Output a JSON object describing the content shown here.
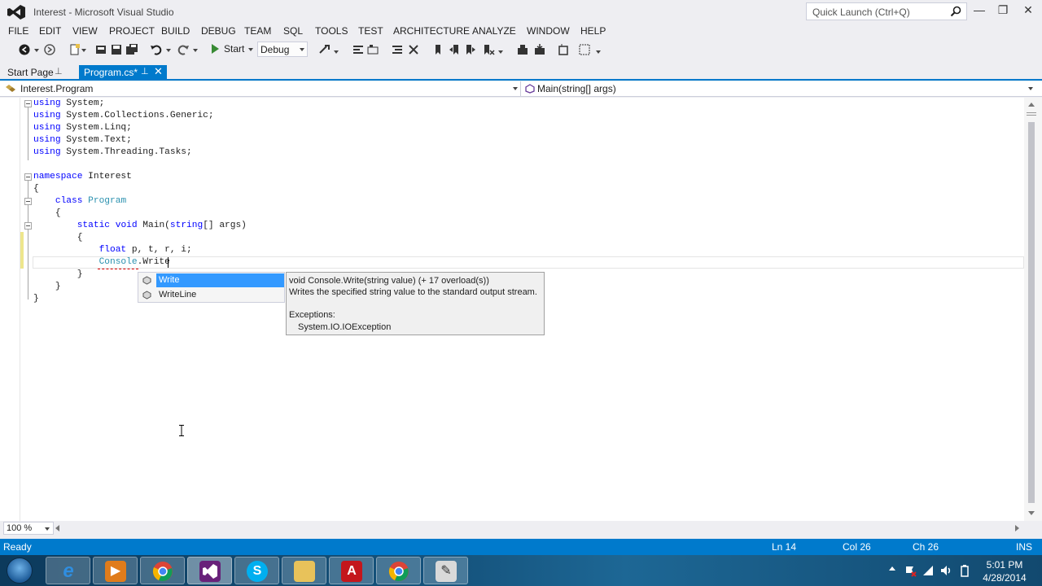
{
  "window": {
    "title": "Interest - Microsoft Visual Studio",
    "quick_launch_placeholder": "Quick Launch (Ctrl+Q)",
    "minimize_glyph": "—",
    "restore_glyph": "❐",
    "close_glyph": "✕"
  },
  "menu": [
    "FILE",
    "EDIT",
    "VIEW",
    "PROJECT",
    "BUILD",
    "DEBUG",
    "TEAM",
    "SQL",
    "TOOLS",
    "TEST",
    "ARCHITECTURE",
    "ANALYZE",
    "WINDOW",
    "HELP"
  ],
  "toolbar": {
    "start_label": "Start",
    "configuration": "Debug"
  },
  "tabs": {
    "start_page": "Start Page",
    "active_file": "Program.cs*",
    "pin_glyph": "⊥",
    "close_glyph": "✕"
  },
  "navbar": {
    "type": "Interest.Program",
    "member": "Main(string[] args)"
  },
  "code": [
    [
      {
        "t": "kw",
        "v": "using"
      },
      {
        "t": "tx",
        "v": " System;"
      }
    ],
    [
      {
        "t": "kw",
        "v": "using"
      },
      {
        "t": "tx",
        "v": " System.Collections.Generic;"
      }
    ],
    [
      {
        "t": "kw",
        "v": "using"
      },
      {
        "t": "tx",
        "v": " System.Linq;"
      }
    ],
    [
      {
        "t": "kw",
        "v": "using"
      },
      {
        "t": "tx",
        "v": " System.Text;"
      }
    ],
    [
      {
        "t": "kw",
        "v": "using"
      },
      {
        "t": "tx",
        "v": " System.Threading.Tasks;"
      }
    ],
    [],
    [
      {
        "t": "kw",
        "v": "namespace"
      },
      {
        "t": "tx",
        "v": " Interest"
      }
    ],
    [
      {
        "t": "tx",
        "v": "{"
      }
    ],
    [
      {
        "t": "tx",
        "v": "    "
      },
      {
        "t": "kw",
        "v": "class"
      },
      {
        "t": "tx",
        "v": " "
      },
      {
        "t": "tp",
        "v": "Program"
      }
    ],
    [
      {
        "t": "tx",
        "v": "    {"
      }
    ],
    [
      {
        "t": "tx",
        "v": "        "
      },
      {
        "t": "kw",
        "v": "static"
      },
      {
        "t": "tx",
        "v": " "
      },
      {
        "t": "kw",
        "v": "void"
      },
      {
        "t": "tx",
        "v": " Main("
      },
      {
        "t": "kw",
        "v": "string"
      },
      {
        "t": "tx",
        "v": "[] args)"
      }
    ],
    [
      {
        "t": "tx",
        "v": "        {"
      }
    ],
    [
      {
        "t": "tx",
        "v": "            "
      },
      {
        "t": "kw",
        "v": "float"
      },
      {
        "t": "tx",
        "v": " p, t, r, i;"
      }
    ],
    [
      {
        "t": "tx",
        "v": "            "
      },
      {
        "t": "tp",
        "v": "Console"
      },
      {
        "t": "tx",
        "v": ".Write"
      }
    ],
    [
      {
        "t": "tx",
        "v": "        }"
      }
    ],
    [
      {
        "t": "tx",
        "v": "    }"
      }
    ],
    [
      {
        "t": "tx",
        "v": "}"
      }
    ]
  ],
  "completion": {
    "items": [
      "Write",
      "WriteLine"
    ],
    "selected_index": 0
  },
  "tooltip": {
    "signature": "void Console.Write(string value)  (+ 17 overload(s))",
    "description": "Writes the specified string value to the standard output stream.",
    "exceptions_label": "Exceptions:",
    "exception": "System.IO.IOException"
  },
  "editor_bottom": {
    "zoom": "100 %"
  },
  "status": {
    "state": "Ready",
    "line": "Ln 14",
    "col": "Col 26",
    "ch": "Ch 26",
    "mode": "INS"
  },
  "taskbar": {
    "time": "5:01 PM",
    "date": "4/28/2014",
    "apps": [
      "internet-explorer-icon",
      "media-player-icon",
      "chrome-icon",
      "visual-studio-icon",
      "skype-icon",
      "file-explorer-icon",
      "acrobat-icon",
      "chrome-icon",
      "notepad-icon"
    ]
  },
  "colors": {
    "accent": "#007acc",
    "keyword": "#0000ff",
    "type": "#2b91af",
    "selection": "#3399ff"
  }
}
